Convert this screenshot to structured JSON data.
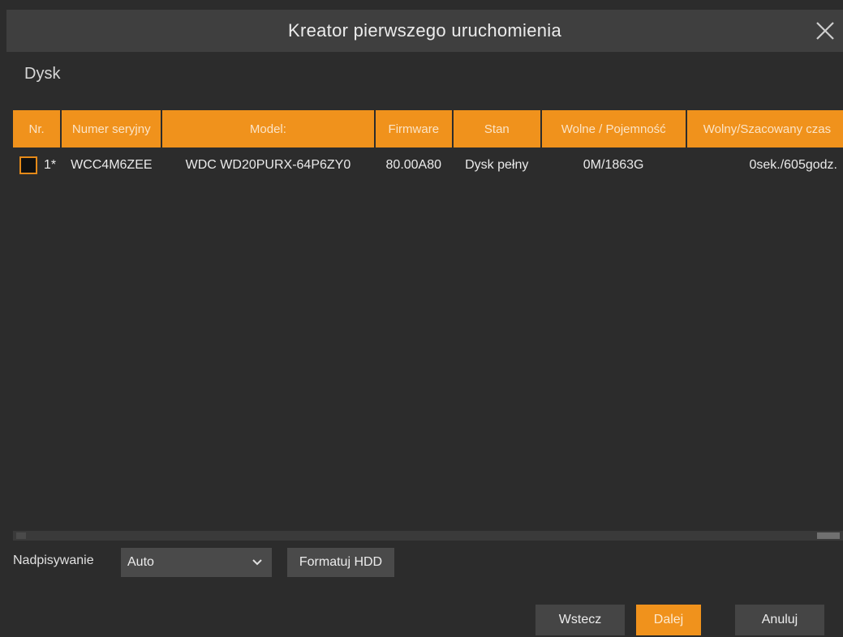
{
  "window": {
    "title": "Kreator pierwszego uruchomienia",
    "close_icon": "close-icon"
  },
  "section": {
    "title": "Dysk"
  },
  "table": {
    "columns": [
      "Nr.",
      "Numer seryjny",
      "Model:",
      "Firmware",
      "Stan",
      "Wolne / Pojemność",
      "Wolny/Szacowany czas"
    ],
    "rows": [
      {
        "nr": "1*",
        "serial": "WCC4M6ZEE",
        "model": "WDC WD20PURX-64P6ZY0",
        "firmware": "80.00A80",
        "status": "Dysk pełny",
        "free_capacity": "0M/1863G",
        "free_time": "0sek./605godz."
      }
    ]
  },
  "controls": {
    "overwrite_label": "Nadpisywanie",
    "overwrite_value": "Auto",
    "format_label": "Formatuj HDD"
  },
  "footer": {
    "back_label": "Wstecz",
    "next_label": "Dalej",
    "cancel_label": "Anuluj"
  },
  "colors": {
    "accent": "#f0921c",
    "background": "#2c2c2c",
    "titlebar": "#3f3f3f"
  }
}
